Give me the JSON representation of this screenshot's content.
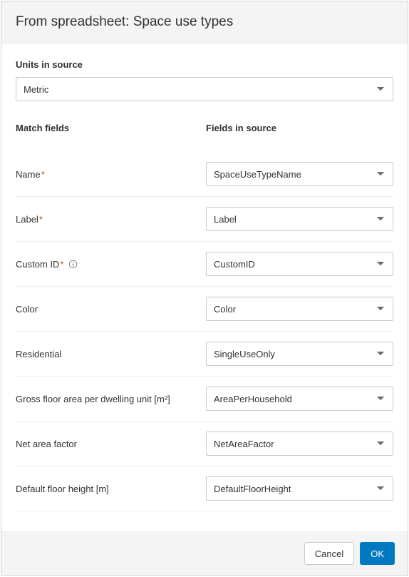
{
  "dialog": {
    "title": "From spreadsheet: Space use types"
  },
  "units": {
    "label": "Units in source",
    "value": "Metric"
  },
  "headers": {
    "match": "Match fields",
    "source": "Fields in source"
  },
  "rows": [
    {
      "label": "Name",
      "required": true,
      "info": false,
      "value": "SpaceUseTypeName"
    },
    {
      "label": "Label",
      "required": true,
      "info": false,
      "value": "Label"
    },
    {
      "label": "Custom ID",
      "required": true,
      "info": true,
      "value": "CustomID"
    },
    {
      "label": "Color",
      "required": false,
      "info": false,
      "value": "Color"
    },
    {
      "label": "Residential",
      "required": false,
      "info": false,
      "value": "SingleUseOnly"
    },
    {
      "label": "Gross floor area per dwelling unit [m²]",
      "required": false,
      "info": false,
      "value": "AreaPerHousehold"
    },
    {
      "label": "Net area factor",
      "required": false,
      "info": false,
      "value": "NetAreaFactor"
    },
    {
      "label": "Default floor height [m]",
      "required": false,
      "info": false,
      "value": "DefaultFloorHeight"
    }
  ],
  "buttons": {
    "cancel": "Cancel",
    "ok": "OK"
  },
  "glyphs": {
    "asterisk": "*"
  }
}
